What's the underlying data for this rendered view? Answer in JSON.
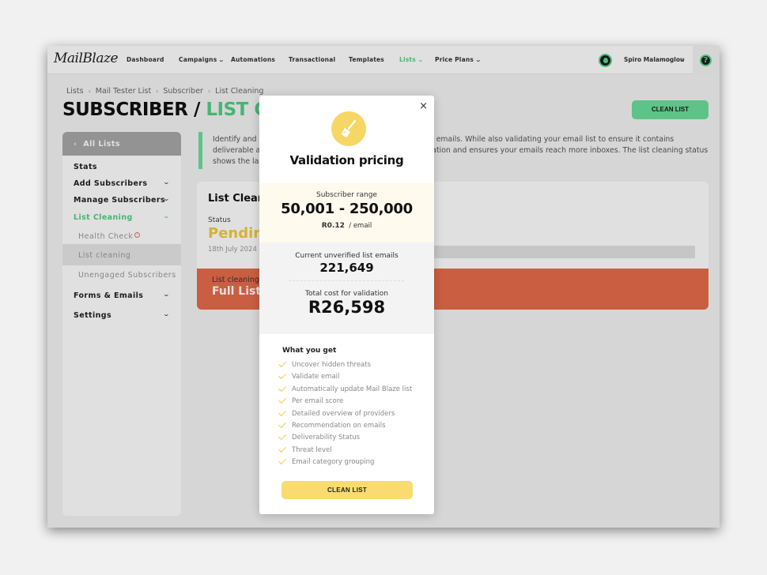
{
  "nav": {
    "logo": "MailBlaze",
    "items": [
      {
        "label": "Dashboard",
        "has_dropdown": false,
        "active": false
      },
      {
        "label": "Campaigns",
        "has_dropdown": true,
        "active": false
      },
      {
        "label": "Automations",
        "has_dropdown": false,
        "active": false
      },
      {
        "label": "Transactional",
        "has_dropdown": false,
        "active": false
      },
      {
        "label": "Templates",
        "has_dropdown": false,
        "active": false
      },
      {
        "label": "Lists",
        "has_dropdown": true,
        "active": true
      },
      {
        "label": "Price Plans",
        "has_dropdown": true,
        "active": false
      }
    ],
    "user_name": "Spiro Malamoglou",
    "help_label": "?",
    "chevron": "⌄"
  },
  "breadcrumb": [
    "Lists",
    "Mail Tester List",
    "Subscriber",
    "List Cleaning"
  ],
  "breadcrumb_sep": "›",
  "page_title": {
    "prefix": "SUBSCRIBER / ",
    "accent": "LIST CLEANING"
  },
  "clean_list_button": "CLEAN LIST",
  "sidebar": {
    "back_label": "All Lists",
    "back_icon": "‹",
    "items": [
      {
        "label": "Stats"
      },
      {
        "label": "Add Subscribers"
      },
      {
        "label": "Manage Subscribers"
      },
      {
        "label": "List Cleaning"
      },
      {
        "label": "Health Check"
      },
      {
        "label": "List cleaning"
      },
      {
        "label": "Unengaged Subscribers"
      },
      {
        "label": "Forms & Emails"
      },
      {
        "label": "Settings"
      }
    ]
  },
  "description": "Identify and remove invalid, risky, bounced and deactivated emails. While also validating your email list to ensure it contains deliverable addresses. This will improve your sending reputation and ensures your emails reach more inboxes. The list cleaning status shows the last check conducted on your list",
  "card": {
    "title": "List Cleaning",
    "status_label": "Status",
    "status_value": "Pending",
    "date": "18th July 2024",
    "progress_fraction": 0,
    "footer_label": "List cleaning",
    "footer_value": "Full List Clean"
  },
  "modal": {
    "close_icon": "×",
    "title": "Validation pricing",
    "range_label": "Subscriber range",
    "range_value": "50,001 - 250,000",
    "price": "R0.12",
    "price_unit": "/ email",
    "unverified_label": "Current unverified list emails",
    "unverified_value": "221,649",
    "total_label": "Total cost for validation",
    "total_value": "R26,598",
    "features_title": "What you get",
    "features": [
      "Uncover hidden threats",
      "Validate email",
      "Automatically update Mail Blaze list",
      "Per email score",
      "Detailed overview of providers",
      "Recommendation on emails",
      "Deliverability Status",
      "Threat level",
      "Email category grouping"
    ],
    "button": "CLEAN LIST"
  },
  "colors": {
    "brand_green": "#4fcf85",
    "button_green": "#6bdf9b",
    "pending_yellow": "#f2cc3a",
    "modal_yellow": "#f9db70",
    "footer_orange": "#e66c4a"
  }
}
